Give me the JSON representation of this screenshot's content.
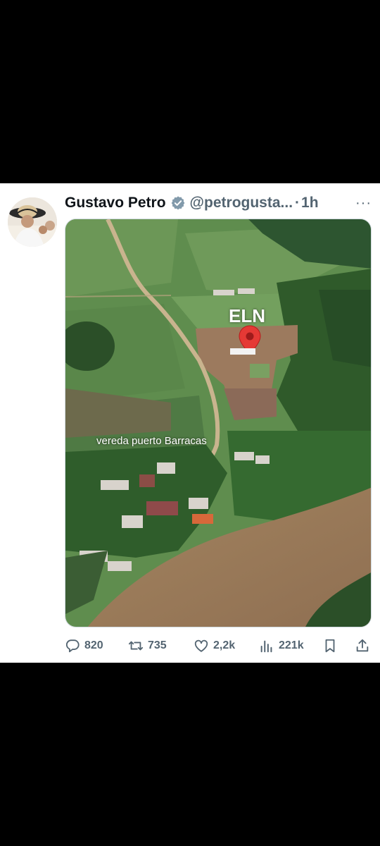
{
  "tweet": {
    "author_name": "Gustavo Petro",
    "handle": "@petrogusta...",
    "separator": "·",
    "time": "1h",
    "more_label": "···"
  },
  "media": {
    "labels": {
      "marker": "ELN",
      "place": "vereda puerto Barracas"
    },
    "colors": {
      "grass": "#5f8d4e",
      "forest": "#2f5a2a",
      "river": "#9a7a5b",
      "marker": "#e53935"
    }
  },
  "actions": {
    "replies": "820",
    "retweets": "735",
    "likes": "2,2k",
    "views": "221k"
  },
  "icons": [
    "verified-badge-icon",
    "reply-icon",
    "retweet-icon",
    "like-icon",
    "views-icon",
    "bookmark-icon",
    "share-icon",
    "location-pin-icon"
  ]
}
